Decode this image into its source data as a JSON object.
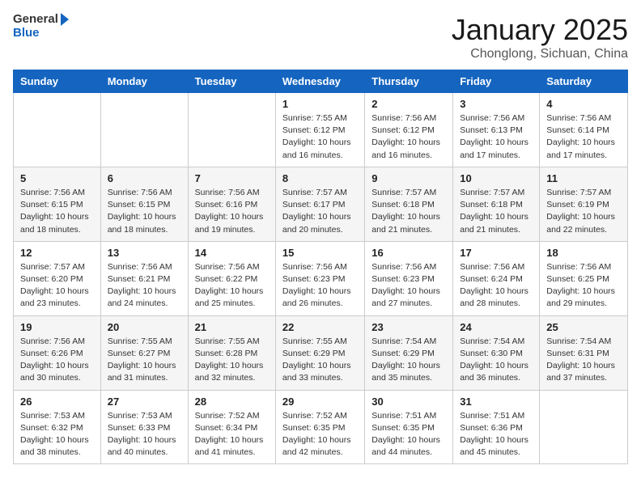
{
  "header": {
    "logo_general": "General",
    "logo_blue": "Blue",
    "month_title": "January 2025",
    "location": "Chonglong, Sichuan, China"
  },
  "days_of_week": [
    "Sunday",
    "Monday",
    "Tuesday",
    "Wednesday",
    "Thursday",
    "Friday",
    "Saturday"
  ],
  "weeks": [
    [
      {
        "day": "",
        "info": ""
      },
      {
        "day": "",
        "info": ""
      },
      {
        "day": "",
        "info": ""
      },
      {
        "day": "1",
        "info": "Sunrise: 7:55 AM\nSunset: 6:12 PM\nDaylight: 10 hours\nand 16 minutes."
      },
      {
        "day": "2",
        "info": "Sunrise: 7:56 AM\nSunset: 6:12 PM\nDaylight: 10 hours\nand 16 minutes."
      },
      {
        "day": "3",
        "info": "Sunrise: 7:56 AM\nSunset: 6:13 PM\nDaylight: 10 hours\nand 17 minutes."
      },
      {
        "day": "4",
        "info": "Sunrise: 7:56 AM\nSunset: 6:14 PM\nDaylight: 10 hours\nand 17 minutes."
      }
    ],
    [
      {
        "day": "5",
        "info": "Sunrise: 7:56 AM\nSunset: 6:15 PM\nDaylight: 10 hours\nand 18 minutes."
      },
      {
        "day": "6",
        "info": "Sunrise: 7:56 AM\nSunset: 6:15 PM\nDaylight: 10 hours\nand 18 minutes."
      },
      {
        "day": "7",
        "info": "Sunrise: 7:56 AM\nSunset: 6:16 PM\nDaylight: 10 hours\nand 19 minutes."
      },
      {
        "day": "8",
        "info": "Sunrise: 7:57 AM\nSunset: 6:17 PM\nDaylight: 10 hours\nand 20 minutes."
      },
      {
        "day": "9",
        "info": "Sunrise: 7:57 AM\nSunset: 6:18 PM\nDaylight: 10 hours\nand 21 minutes."
      },
      {
        "day": "10",
        "info": "Sunrise: 7:57 AM\nSunset: 6:18 PM\nDaylight: 10 hours\nand 21 minutes."
      },
      {
        "day": "11",
        "info": "Sunrise: 7:57 AM\nSunset: 6:19 PM\nDaylight: 10 hours\nand 22 minutes."
      }
    ],
    [
      {
        "day": "12",
        "info": "Sunrise: 7:57 AM\nSunset: 6:20 PM\nDaylight: 10 hours\nand 23 minutes."
      },
      {
        "day": "13",
        "info": "Sunrise: 7:56 AM\nSunset: 6:21 PM\nDaylight: 10 hours\nand 24 minutes."
      },
      {
        "day": "14",
        "info": "Sunrise: 7:56 AM\nSunset: 6:22 PM\nDaylight: 10 hours\nand 25 minutes."
      },
      {
        "day": "15",
        "info": "Sunrise: 7:56 AM\nSunset: 6:23 PM\nDaylight: 10 hours\nand 26 minutes."
      },
      {
        "day": "16",
        "info": "Sunrise: 7:56 AM\nSunset: 6:23 PM\nDaylight: 10 hours\nand 27 minutes."
      },
      {
        "day": "17",
        "info": "Sunrise: 7:56 AM\nSunset: 6:24 PM\nDaylight: 10 hours\nand 28 minutes."
      },
      {
        "day": "18",
        "info": "Sunrise: 7:56 AM\nSunset: 6:25 PM\nDaylight: 10 hours\nand 29 minutes."
      }
    ],
    [
      {
        "day": "19",
        "info": "Sunrise: 7:56 AM\nSunset: 6:26 PM\nDaylight: 10 hours\nand 30 minutes."
      },
      {
        "day": "20",
        "info": "Sunrise: 7:55 AM\nSunset: 6:27 PM\nDaylight: 10 hours\nand 31 minutes."
      },
      {
        "day": "21",
        "info": "Sunrise: 7:55 AM\nSunset: 6:28 PM\nDaylight: 10 hours\nand 32 minutes."
      },
      {
        "day": "22",
        "info": "Sunrise: 7:55 AM\nSunset: 6:29 PM\nDaylight: 10 hours\nand 33 minutes."
      },
      {
        "day": "23",
        "info": "Sunrise: 7:54 AM\nSunset: 6:29 PM\nDaylight: 10 hours\nand 35 minutes."
      },
      {
        "day": "24",
        "info": "Sunrise: 7:54 AM\nSunset: 6:30 PM\nDaylight: 10 hours\nand 36 minutes."
      },
      {
        "day": "25",
        "info": "Sunrise: 7:54 AM\nSunset: 6:31 PM\nDaylight: 10 hours\nand 37 minutes."
      }
    ],
    [
      {
        "day": "26",
        "info": "Sunrise: 7:53 AM\nSunset: 6:32 PM\nDaylight: 10 hours\nand 38 minutes."
      },
      {
        "day": "27",
        "info": "Sunrise: 7:53 AM\nSunset: 6:33 PM\nDaylight: 10 hours\nand 40 minutes."
      },
      {
        "day": "28",
        "info": "Sunrise: 7:52 AM\nSunset: 6:34 PM\nDaylight: 10 hours\nand 41 minutes."
      },
      {
        "day": "29",
        "info": "Sunrise: 7:52 AM\nSunset: 6:35 PM\nDaylight: 10 hours\nand 42 minutes."
      },
      {
        "day": "30",
        "info": "Sunrise: 7:51 AM\nSunset: 6:35 PM\nDaylight: 10 hours\nand 44 minutes."
      },
      {
        "day": "31",
        "info": "Sunrise: 7:51 AM\nSunset: 6:36 PM\nDaylight: 10 hours\nand 45 minutes."
      },
      {
        "day": "",
        "info": ""
      }
    ]
  ]
}
